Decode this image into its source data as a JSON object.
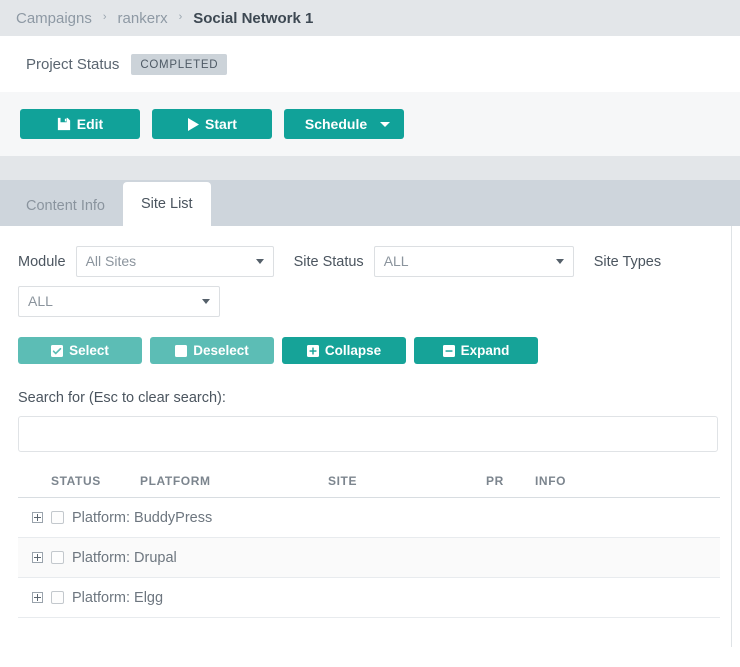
{
  "breadcrumb": {
    "items": [
      {
        "label": "Campaigns",
        "current": false
      },
      {
        "label": "rankerx",
        "current": false
      },
      {
        "label": "Social Network 1",
        "current": true
      }
    ],
    "separator": "›"
  },
  "project": {
    "status_label": "Project Status",
    "status_badge": "COMPLETED"
  },
  "toolbar": {
    "edit_label": "Edit",
    "start_label": "Start",
    "schedule_label": "Schedule"
  },
  "tabs": [
    {
      "label": "Content Info",
      "active": false
    },
    {
      "label": "Site List",
      "active": true
    }
  ],
  "filters": {
    "module_label": "Module",
    "module_value": "All Sites",
    "site_status_label": "Site Status",
    "site_status_value": "ALL",
    "site_types_label": "Site Types",
    "site_types_value": "ALL"
  },
  "selection_buttons": {
    "select_label": "Select",
    "deselect_label": "Deselect",
    "collapse_label": "Collapse",
    "expand_label": "Expand"
  },
  "search": {
    "label": "Search for (Esc to clear search):",
    "value": "",
    "placeholder": ""
  },
  "table": {
    "columns": [
      "STATUS",
      "PLATFORM",
      "SITE",
      "PR",
      "INFO"
    ],
    "rows": [
      {
        "label": "Platform: BuddyPress",
        "checked": false,
        "expanded": false
      },
      {
        "label": "Platform: Drupal",
        "checked": false,
        "expanded": false
      },
      {
        "label": "Platform: Elgg",
        "checked": false,
        "expanded": false
      }
    ]
  },
  "colors": {
    "accent_teal": "#11a299",
    "accent_teal_light": "#5cbdb5",
    "breadcrumb_bg": "#e3e6e9",
    "tabstrip_bg": "#ced5dc",
    "badge_bg": "#ccd3d9"
  }
}
